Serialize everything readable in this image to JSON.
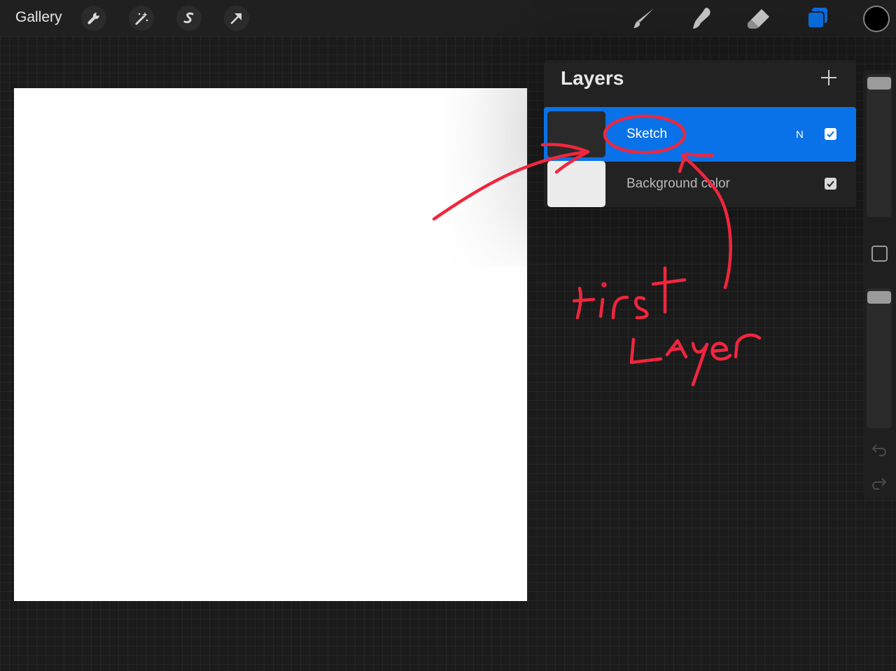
{
  "toolbar": {
    "gallery_label": "Gallery",
    "left_icons": [
      "wrench-icon",
      "magic-wand-icon",
      "selection-icon",
      "transform-arrow-icon"
    ],
    "right_icons": [
      "brush-icon",
      "smudge-icon",
      "eraser-icon",
      "layers-icon"
    ],
    "active_tool": "layers-icon",
    "current_color": "#000000",
    "accent_color": "#0a72e8"
  },
  "layers_panel": {
    "title": "Layers",
    "add_icon": "plus-icon",
    "layers": [
      {
        "name": "Sketch",
        "blend_mode": "N",
        "visible": true,
        "selected": true
      },
      {
        "name": "Background color",
        "visible": true,
        "selected": false
      }
    ]
  },
  "sidebar": {
    "brush_size": 1.0,
    "opacity": 1.0,
    "icons": [
      "modify-square-icon",
      "undo-icon",
      "redo-icon"
    ]
  },
  "annotation": {
    "color": "#f0263d"
  }
}
